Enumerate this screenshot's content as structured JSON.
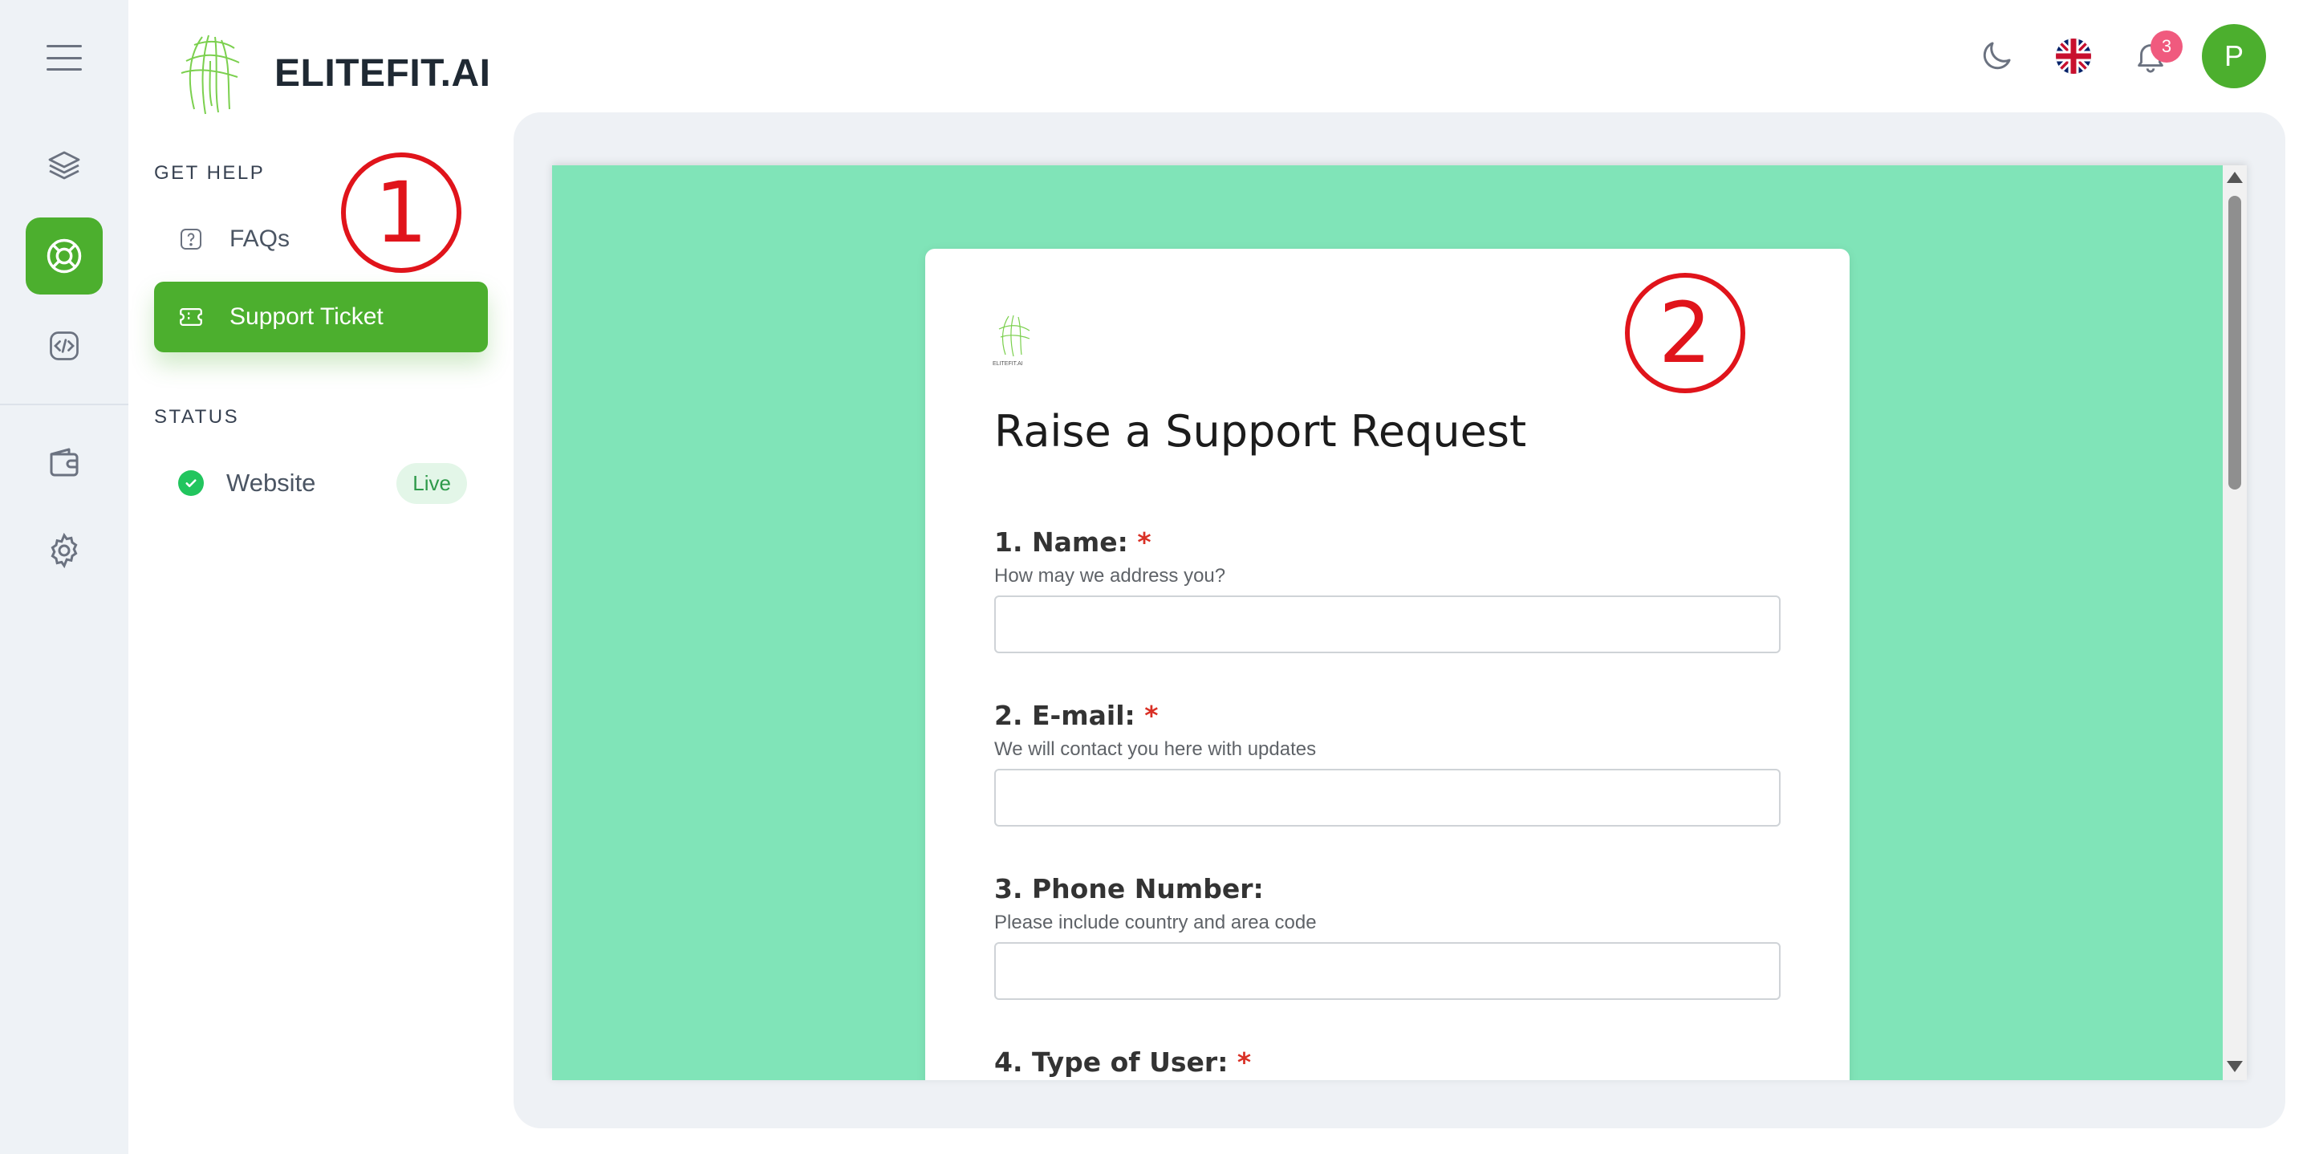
{
  "brand": {
    "name": "ELITEFIT.AI",
    "card_logo_text": "ELITEFIT.AI"
  },
  "rail": {
    "items": [
      {
        "name": "menu-icon"
      },
      {
        "name": "layers-icon"
      },
      {
        "name": "lifebuoy-icon",
        "active": true
      },
      {
        "name": "code-icon"
      },
      {
        "name": "wallet-icon"
      },
      {
        "name": "settings-icon"
      }
    ]
  },
  "sidebar": {
    "get_help_title": "GET HELP",
    "items": [
      {
        "label": "FAQs",
        "icon": "question-icon"
      },
      {
        "label": "Support Ticket",
        "icon": "ticket-icon",
        "active": true
      }
    ],
    "status_title": "STATUS",
    "status_items": [
      {
        "label": "Website",
        "badge": "Live"
      }
    ]
  },
  "annotations": {
    "one": "1",
    "two": "2"
  },
  "topbar": {
    "notification_count": "3",
    "avatar_initial": "P"
  },
  "form": {
    "title": "Raise a Support Request",
    "questions": [
      {
        "label": "1. Name:",
        "required": "*",
        "help": "How may we address you?"
      },
      {
        "label": "2. E-mail:",
        "required": "*",
        "help": "We will contact you here with updates"
      },
      {
        "label": "3. Phone Number:",
        "required": "",
        "help": "Please include country and area code"
      },
      {
        "label": "4. Type of User:",
        "required": "*",
        "help": ""
      }
    ]
  },
  "colors": {
    "accent": "#4caf2e",
    "form_background": "#80e4b8",
    "annotation": "#e0141b",
    "badge": "#f05a7e"
  }
}
